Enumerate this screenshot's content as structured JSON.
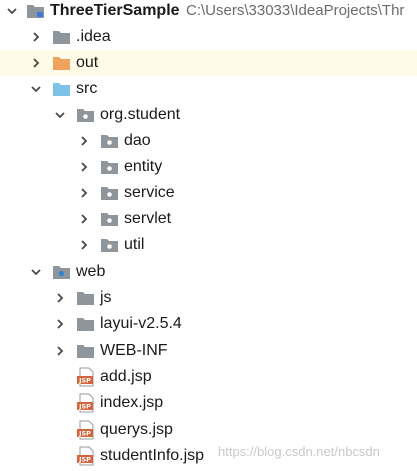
{
  "project": {
    "name": "ThreeTierSample",
    "path": "C:\\Users\\33033\\IdeaProjects\\Thr"
  },
  "tree": [
    {
      "label": ".idea",
      "icon": "folder-icon",
      "arrow": "right"
    },
    {
      "label": "out",
      "icon": "excluded-folder-icon",
      "arrow": "right",
      "highlight": true
    },
    {
      "label": "src",
      "icon": "source-folder-icon",
      "arrow": "down"
    },
    {
      "label": "org.student",
      "icon": "package-icon",
      "arrow": "down"
    },
    {
      "label": "dao",
      "icon": "package-icon",
      "arrow": "right"
    },
    {
      "label": "entity",
      "icon": "package-icon",
      "arrow": "right"
    },
    {
      "label": "service",
      "icon": "package-icon",
      "arrow": "right"
    },
    {
      "label": "servlet",
      "icon": "package-icon",
      "arrow": "right"
    },
    {
      "label": "util",
      "icon": "package-icon",
      "arrow": "right"
    },
    {
      "label": "web",
      "icon": "web-folder-icon",
      "arrow": "down"
    },
    {
      "label": "js",
      "icon": "folder-icon",
      "arrow": "right"
    },
    {
      "label": "layui-v2.5.4",
      "icon": "folder-icon",
      "arrow": "right"
    },
    {
      "label": "WEB-INF",
      "icon": "folder-icon",
      "arrow": "right"
    },
    {
      "label": "add.jsp",
      "icon": "jsp-file-icon"
    },
    {
      "label": "index.jsp",
      "icon": "jsp-file-icon"
    },
    {
      "label": "querys.jsp",
      "icon": "jsp-file-icon"
    },
    {
      "label": "studentInfo.jsp",
      "icon": "jsp-file-icon"
    }
  ],
  "jsp_badge": "JSP",
  "watermark": "https://blog.csdn.net/nbcsdn",
  "colors": {
    "folder": "#8e959b",
    "excluded_folder": "#f0a35c",
    "source_folder": "#7dc3e8",
    "arrow": "#4a4a4a",
    "highlight": "#fefbe8",
    "jsp_badge": "#d5643c"
  }
}
